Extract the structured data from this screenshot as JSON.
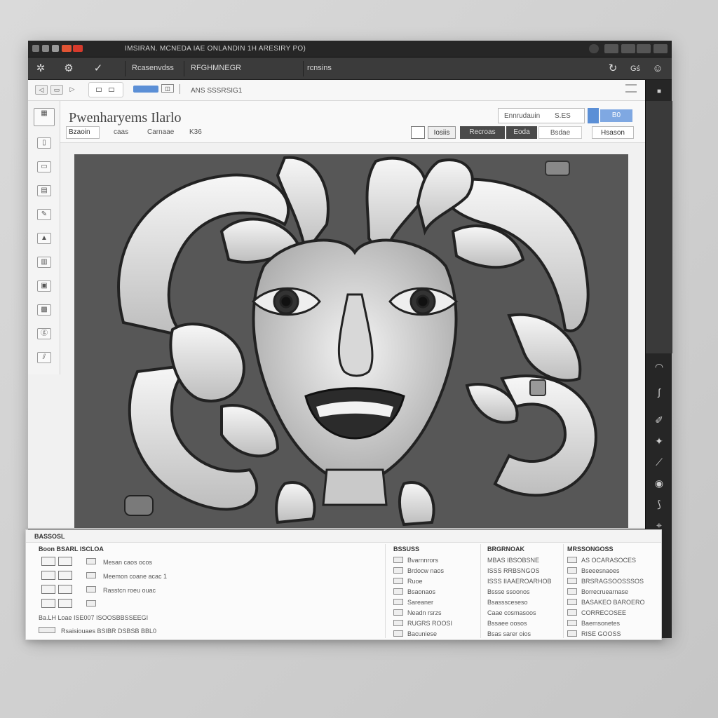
{
  "window": {
    "title": "IMSIRAN. MCNEDA IAE ONLANDIN 1H ARESIRY PO)"
  },
  "toolbar": {
    "label_left": "Rcasenvdss",
    "label_mid": "RFGHMNEGR",
    "label_right": "rcnsins"
  },
  "nav": {
    "search_value": "",
    "field_text": "ANS SSSRSIG1"
  },
  "document": {
    "title": "Pwenharyems Ilarlo",
    "tabs": [
      "Bzaoin",
      "caas",
      "Carnaae",
      "K36"
    ],
    "header_left_label": "Iosiis",
    "header_btn_1": "Recroas",
    "header_btn_2": "Eoda",
    "header_btn_3": "Bsdae",
    "header_btn_4": "Hsason",
    "top_search": "Ennrudauin",
    "top_search_suffix": "S.ES",
    "top_btn": "B0"
  },
  "bottom": {
    "header": "BASSOSL",
    "left": {
      "title": "Boon BSARL ISCLOA",
      "rows": [
        "Mesan caos ocos",
        "Meemon coane acac 1",
        "Rasstcn roeu ouac"
      ],
      "footer_1": "Ba.LH Loae ISE007 ISOOSBBSSEEGI",
      "footer_2": "Rsaisiouaes BSIBR DSBSB BBL0"
    },
    "col1": {
      "title": "BSSUSS",
      "rows": [
        "Bvarnnrors",
        "Brdocw naos",
        "Ruoe",
        "Bsaonaos",
        "Sareaner",
        "Neadn rsrzs",
        "RUGRS ROOSI",
        "Bacuniese"
      ]
    },
    "col2": {
      "title": "BRGRNOAK",
      "rows": [
        "MBAS IBSOBSNE",
        "ISSS RRBSNGOS",
        "ISSS IIAAEROARHOB",
        "Bssse ssoonos",
        "Bsasssceseso",
        "Caae cosmasoos",
        "Bssaee oosos",
        "Bsas sarer oios"
      ]
    },
    "col3": {
      "title": "MRSSONGOSS",
      "rows": [
        "AS OCARASOCES",
        "Bseeesnaoes",
        "BRSRAGSOOSSSOS",
        "Borrecruearnase",
        "BASAKEO BAROERO",
        "CORRECOSEE",
        "Baemsonetes",
        "RISE GOOSS"
      ]
    }
  },
  "colors": {
    "accent_blue": "#5b8fd6",
    "tab_dark": "#4a4a4a",
    "close_red": "#d63a2c"
  }
}
